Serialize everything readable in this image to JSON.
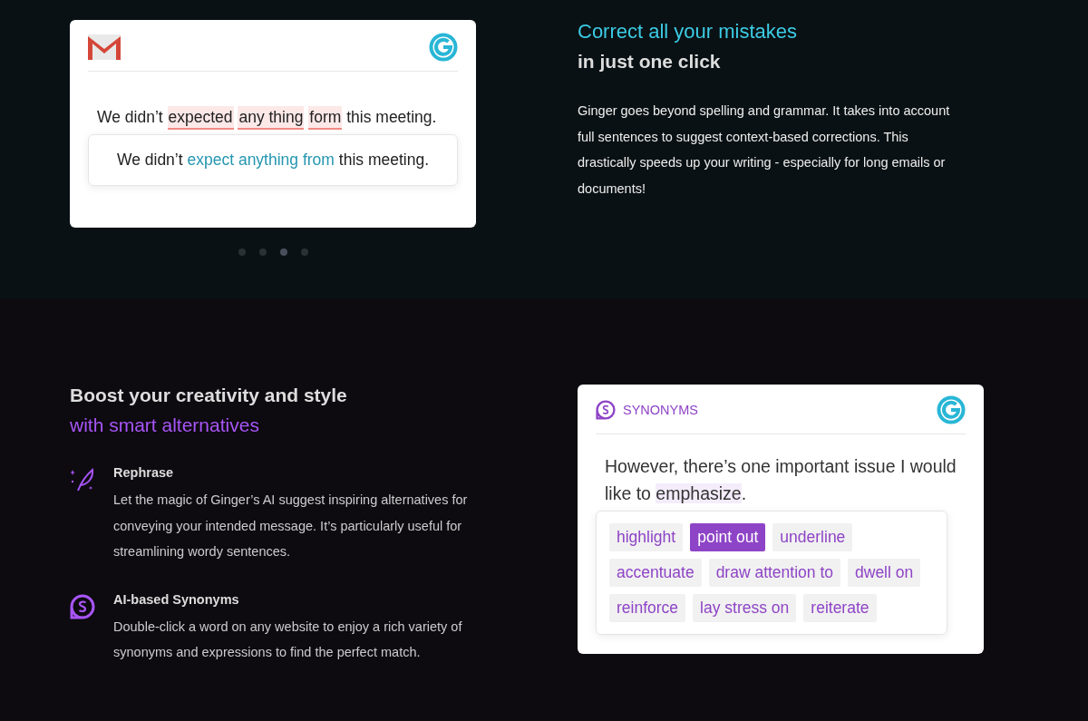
{
  "correct_section": {
    "demo_card": {
      "original": [
        {
          "text": "We didn’t",
          "kind": "plain"
        },
        {
          "text": "expected",
          "kind": "error"
        },
        {
          "text": "any thing",
          "kind": "error"
        },
        {
          "text": "form",
          "kind": "error"
        },
        {
          "text": "this meeting.",
          "kind": "plain"
        }
      ],
      "corrected": [
        {
          "text": "We didn’t",
          "kind": "plain"
        },
        {
          "text": "expect anything from",
          "kind": "fix"
        },
        {
          "text": "this meeting.",
          "kind": "plain"
        }
      ]
    },
    "carousel_dots": [
      {
        "selected": false
      },
      {
        "selected": false
      },
      {
        "selected": true
      },
      {
        "selected": false
      }
    ],
    "title": "Correct all your mistakes",
    "subtitle": "in just one click",
    "body": "Ginger goes beyond spelling and grammar. It takes into account full sentences to suggest context-based corrections. This drastically speeds up your writing - especially for long emails or documents!"
  },
  "boost_section": {
    "title": "Boost your creativity and style",
    "subtitle": "with smart alternatives",
    "features": [
      {
        "kind": "rephrase",
        "title": "Rephrase",
        "body": "Let the magic of Ginger’s AI suggest inspiring alternatives for conveying your intended message. It’s particularly useful for streamlining wordy sentences."
      },
      {
        "kind": "synonyms",
        "title": "AI-based Synonyms",
        "body": "Double-click a word on any website to enjoy a rich variety of synonyms and expressions to find the perfect match."
      }
    ],
    "synonyms_card": {
      "label": "SYNONYMS",
      "sentence": [
        {
          "text": "However, there’s one important issue I would like to ",
          "kind": "plain"
        },
        {
          "text": "emphasize",
          "kind": "target"
        },
        {
          "text": ".",
          "kind": "plain"
        }
      ],
      "options": [
        {
          "text": "highlight",
          "selected": false
        },
        {
          "text": "point out",
          "selected": true
        },
        {
          "text": "underline",
          "selected": false
        },
        {
          "text": "accentuate",
          "selected": false
        },
        {
          "text": "draw attention to",
          "selected": false
        },
        {
          "text": "dwell on",
          "selected": false
        },
        {
          "text": "reinforce",
          "selected": false
        },
        {
          "text": "lay stress on",
          "selected": false
        },
        {
          "text": "reiterate",
          "selected": false
        }
      ]
    }
  }
}
